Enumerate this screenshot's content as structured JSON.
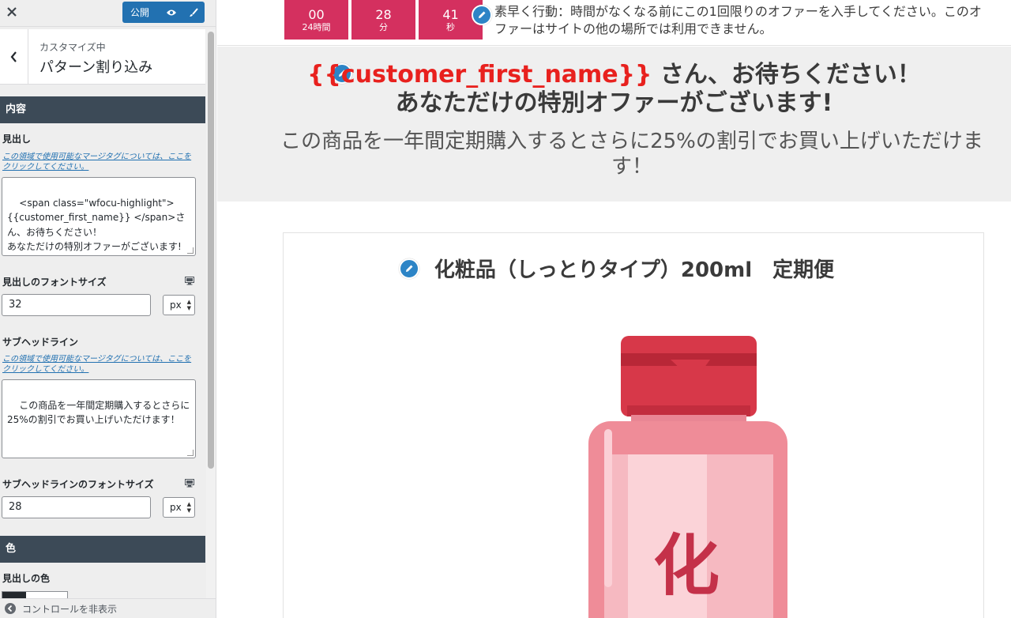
{
  "sidebar": {
    "publish_label": "公開",
    "customizing_label": "カスタマイズ中",
    "panel_title": "パターン割り込み",
    "sections": {
      "content": "内容",
      "color": "色"
    },
    "fields": {
      "headline_label": "見出し",
      "headline_help": "この領域で使用可能なマージタグについては、ここをクリックしてください。",
      "headline_value": "<span class=\"wfocu-highlight\">\n{{customer_first_name}} </span>さん、お待ちください！\nあなただけの特別オファーがございます!",
      "headline_font_size_label": "見出しのフォントサイズ",
      "headline_font_size": "32",
      "headline_unit": "px",
      "subheadline_label": "サブヘッドライン",
      "subheadline_help": "この領域で使用可能なマージタグについては、ここをクリックしてください。",
      "subheadline_value": "この商品を一年間定期購入するとさらに25%の割引でお買い上げいただけます！",
      "subheadline_font_size_label": "サブヘッドラインのフォントサイズ",
      "subheadline_font_size": "28",
      "subheadline_unit": "px",
      "headline_color_label": "見出しの色"
    },
    "footer_label": "コントロールを非表示"
  },
  "preview": {
    "timer": [
      {
        "value": "00",
        "unit": "24時間"
      },
      {
        "value": "28",
        "unit": "分"
      },
      {
        "value": "41",
        "unit": "秒"
      }
    ],
    "urgency_text": "素早く行動：時間がなくなる前にこの1回限りのオファーを入手してください。このオファーはサイトの他の場所では利用できません。",
    "headline_highlight": "{{customer_first_name}}",
    "headline_rest": " さん、お待ちください！",
    "headline_line2": "あなただけの特別オファーがございます!",
    "subheadline": "この商品を一年間定期購入するとさらに25%の割引でお買い上げいただけます！",
    "product_title": "化粧品（しっとりタイプ）200ml　定期便",
    "bottle_label": "化"
  },
  "colors": {
    "accent_blue": "#2271b1",
    "timer_pink": "#d4305f",
    "highlight_red": "#e8211e",
    "section_bar": "#3c4a57"
  }
}
